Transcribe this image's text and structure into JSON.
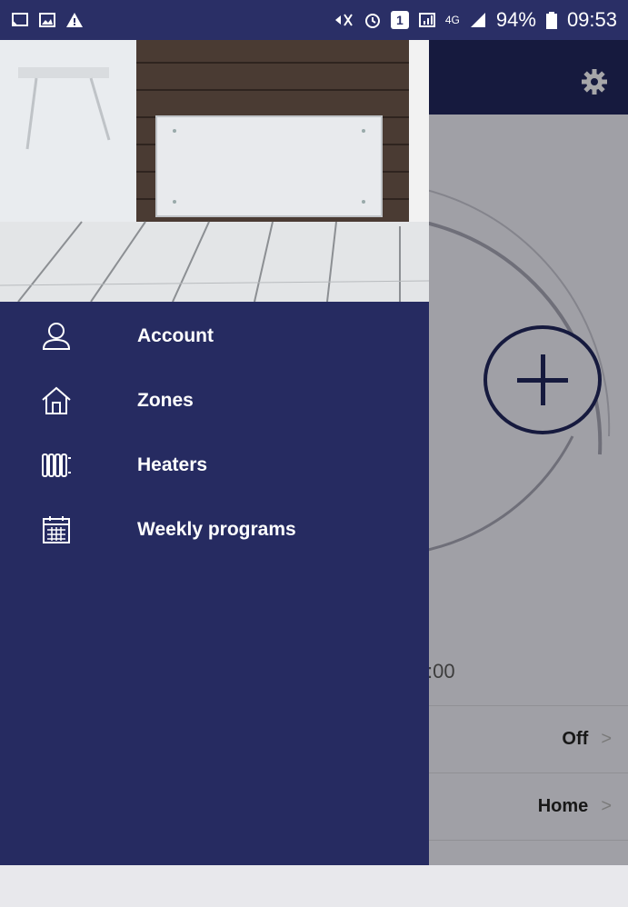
{
  "status_bar": {
    "battery_percent": "94%",
    "time": "09:53",
    "network": "4G",
    "sim_slot": "1",
    "icons": [
      "cast-icon",
      "image-icon",
      "warning-icon",
      "mute-icon",
      "alarm-icon",
      "sim-icon",
      "signal-icon",
      "battery-icon"
    ]
  },
  "drawer": {
    "menu": [
      {
        "label": "Account",
        "icon": "person-icon"
      },
      {
        "label": "Zones",
        "icon": "house-icon"
      },
      {
        "label": "Heaters",
        "icon": "radiator-icon"
      },
      {
        "label": "Weekly programs",
        "icon": "calendar-icon"
      }
    ]
  },
  "background_app": {
    "settings_icon": "gear-icon",
    "time_partial": ":00",
    "rows": [
      {
        "label": "Off"
      },
      {
        "label": "Home"
      }
    ],
    "chevron": ">",
    "colors": {
      "header": "#1f2457",
      "drawer": "#262b61"
    }
  }
}
